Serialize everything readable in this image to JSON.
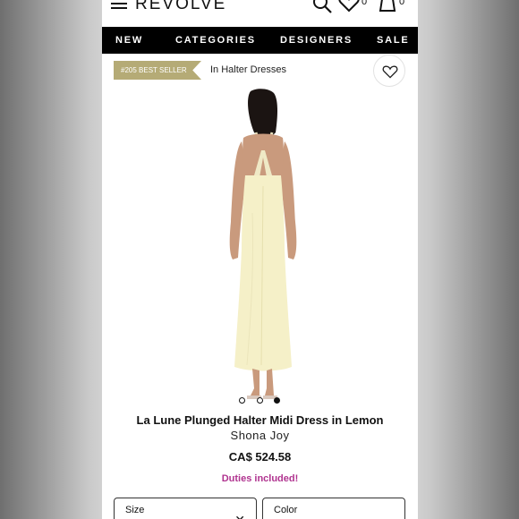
{
  "header": {
    "logo": "REVOLVE",
    "wishlist_count": "0",
    "bag_count": "0"
  },
  "nav": {
    "items": [
      "NEW",
      "CATEGORIES",
      "DESIGNERS",
      "SALE"
    ]
  },
  "product": {
    "badge": "#205 BEST SELLER",
    "breadcrumb": "In Halter Dresses",
    "title": "La Lune Plunged Halter Midi Dress in Lemon",
    "brand": "Shona Joy",
    "price": "CA$ 524.58",
    "duties": "Duties included!",
    "image_count": 3,
    "active_image": 3,
    "dress_color": "#f5f0c8"
  },
  "options": {
    "size_label": "Size",
    "color_label": "Color"
  },
  "colors": {
    "nav_bg": "#000000",
    "badge": "#b5ab76",
    "duties": "#b0338f"
  }
}
